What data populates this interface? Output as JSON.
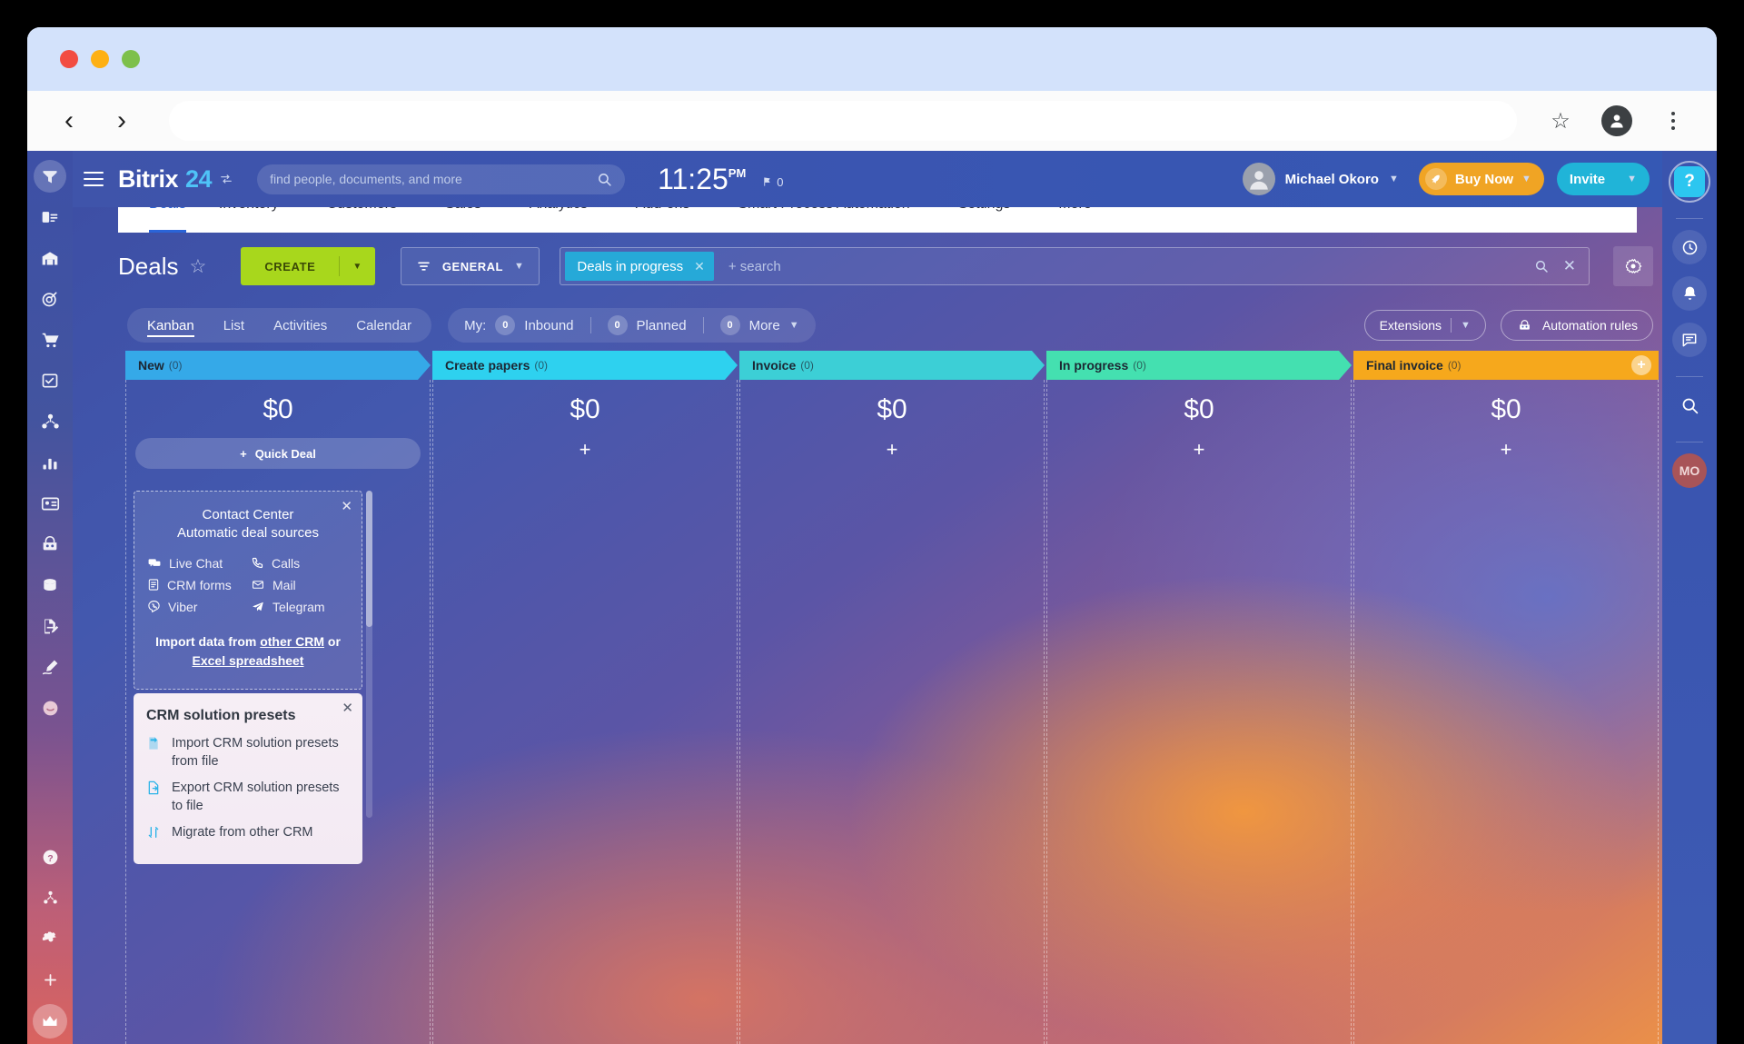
{
  "browser": {
    "back_label": "back",
    "forward_label": "forward",
    "url_value": "",
    "bookmark_icon": "star-icon",
    "profile_icon": "profile-icon",
    "menu_icon": "kebab-menu-icon"
  },
  "header": {
    "logo_main": "Bitrix",
    "logo_accent": "24",
    "search_placeholder": "find people, documents, and more",
    "clock_time": "11:25",
    "clock_meridiem": "PM",
    "flag_count": "0",
    "user_name": "Michael Okoro",
    "buy_label": "Buy Now",
    "invite_label": "Invite"
  },
  "menu": {
    "items": [
      {
        "label": "Deals",
        "has_caret": false,
        "active": true
      },
      {
        "label": "Inventory",
        "has_caret": true,
        "active": false
      },
      {
        "label": "Customers",
        "has_caret": true,
        "active": false
      },
      {
        "label": "Sales",
        "has_caret": true,
        "active": false
      },
      {
        "label": "Analytics",
        "has_caret": true,
        "active": false
      },
      {
        "label": "Add-ons",
        "has_caret": true,
        "active": false
      },
      {
        "label": "Smart Process Automation",
        "has_caret": true,
        "active": false
      },
      {
        "label": "Settings",
        "has_caret": true,
        "active": false
      },
      {
        "label": "More",
        "has_caret": true,
        "active": false
      }
    ]
  },
  "toolbar": {
    "page_title": "Deals",
    "create_label": "CREATE",
    "filter_label": "GENERAL",
    "filter_chip": "Deals in progress",
    "search_placeholder": "+ search",
    "settings_icon": "gear-icon"
  },
  "views": {
    "tabs": [
      {
        "label": "Kanban",
        "active": true
      },
      {
        "label": "List",
        "active": false
      },
      {
        "label": "Activities",
        "active": false
      },
      {
        "label": "Calendar",
        "active": false
      }
    ],
    "my_label": "My:",
    "counters": [
      {
        "count": "0",
        "label": "Inbound"
      },
      {
        "count": "0",
        "label": "Planned"
      },
      {
        "count": "0",
        "label": "More"
      }
    ],
    "extensions_label": "Extensions",
    "automation_label": "Automation rules"
  },
  "kanban": {
    "columns": [
      {
        "name": "New",
        "count": "(0)",
        "sum": "$0",
        "color": "#35a9e8",
        "action": "Quick Deal"
      },
      {
        "name": "Create papers",
        "count": "(0)",
        "sum": "$0",
        "color": "#2ed1ef",
        "action": "+"
      },
      {
        "name": "Invoice",
        "count": "(0)",
        "sum": "$0",
        "color": "#3ccfd6",
        "action": "+"
      },
      {
        "name": "In progress",
        "count": "(0)",
        "sum": "$0",
        "color": "#44e0b0",
        "action": "+"
      },
      {
        "name": "Final invoice",
        "count": "(0)",
        "sum": "$0",
        "color": "#f6a81c",
        "action": "+"
      }
    ],
    "add_column_icon": "plus-circle-icon"
  },
  "contact_center_panel": {
    "title_line1": "Contact Center",
    "title_line2": "Automatic deal sources",
    "sources": [
      {
        "label": "Live Chat",
        "icon": "chat-icon"
      },
      {
        "label": "Calls",
        "icon": "phone-icon"
      },
      {
        "label": "CRM forms",
        "icon": "form-icon"
      },
      {
        "label": "Mail",
        "icon": "mail-icon"
      },
      {
        "label": "Viber",
        "icon": "viber-icon"
      },
      {
        "label": "Telegram",
        "icon": "telegram-icon"
      }
    ],
    "import_prefix": "Import data from ",
    "import_link1": "other CRM",
    "import_middle": " or ",
    "import_link2": "Excel spreadsheet",
    "close_icon": "close-icon"
  },
  "presets_panel": {
    "title": "CRM solution presets",
    "items": [
      {
        "label": "Import CRM solution presets from file",
        "icon": "import-file-icon"
      },
      {
        "label": "Export CRM solution presets to file",
        "icon": "export-file-icon"
      },
      {
        "label": "Migrate from other CRM",
        "icon": "migrate-icon"
      }
    ],
    "close_icon": "close-icon"
  },
  "left_rail": {
    "items": [
      {
        "icon": "crm-funnel-icon",
        "active": true
      },
      {
        "icon": "contacts-icon",
        "active": false
      },
      {
        "icon": "warehouse-icon",
        "active": false
      },
      {
        "icon": "target-icon",
        "active": false
      },
      {
        "icon": "cart-icon",
        "active": false
      },
      {
        "icon": "tasks-icon",
        "active": false
      },
      {
        "icon": "network-icon",
        "active": false
      },
      {
        "icon": "analytics-icon",
        "active": false
      },
      {
        "icon": "id-card-icon",
        "active": false
      },
      {
        "icon": "robot-icon",
        "active": false
      },
      {
        "icon": "drive-icon",
        "active": false
      },
      {
        "icon": "sign-doc-icon",
        "active": false
      },
      {
        "icon": "pen-icon",
        "active": false
      },
      {
        "icon": "smiley-icon",
        "active": false
      }
    ],
    "bottom_items": [
      {
        "icon": "help-icon"
      },
      {
        "icon": "sitemap-icon"
      },
      {
        "icon": "settings-gear-icon"
      },
      {
        "icon": "plus-icon"
      }
    ],
    "crown_icon": "crown-icon"
  },
  "right_rail": {
    "help_icon": "help-question-icon",
    "items": [
      {
        "icon": "history-clock-icon"
      },
      {
        "icon": "notifications-bell-icon"
      },
      {
        "icon": "chat-bubble-icon"
      },
      {
        "icon": "search-icon"
      }
    ],
    "avatar_initials": "MO"
  },
  "colors": {
    "brand_blue": "#2a64d8",
    "create_green": "#a8d71c",
    "buy_orange": "#f0a424",
    "invite_cyan": "#20b4d8",
    "chip_blue": "#26a9d8"
  }
}
